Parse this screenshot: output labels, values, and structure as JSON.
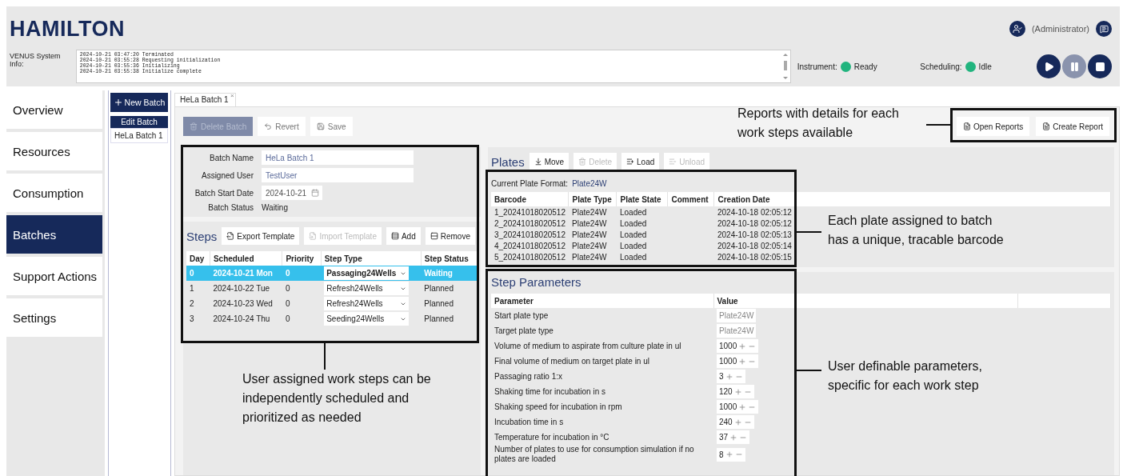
{
  "header": {
    "logo": "HAMILTON",
    "user": "(Administrator)"
  },
  "system_info": {
    "label": "VENUS System Info:",
    "log": [
      "2024-10-21 03:47:20 Terminated",
      "2024-10-21 03:55:28 Requesting initialization",
      "2024-10-21 03:55:36 Initializing",
      "2024-10-21 03:55:38 Initialize complete"
    ]
  },
  "status": [
    {
      "label": "Instrument:",
      "value": "Ready",
      "color": "#21b47e"
    },
    {
      "label": "Scheduling:",
      "value": "Idle",
      "color": "#21b47e"
    }
  ],
  "run_controls": [
    {
      "kind": "play",
      "disabled": false
    },
    {
      "kind": "pause",
      "disabled": true
    },
    {
      "kind": "stop",
      "disabled": false
    }
  ],
  "nav": [
    {
      "label": "Overview",
      "selected": false
    },
    {
      "label": "Resources",
      "selected": false
    },
    {
      "label": "Consumption",
      "selected": false
    },
    {
      "label": "Batches",
      "selected": true
    },
    {
      "label": "Support Actions",
      "selected": false
    },
    {
      "label": "Settings",
      "selected": false
    }
  ],
  "batch_list": {
    "new_button": "New Batch",
    "heading": "Edit Batch",
    "items": [
      "HeLa Batch 1"
    ]
  },
  "tabs": [
    {
      "label": "HeLa Batch 1",
      "selected": true,
      "close": "×"
    }
  ],
  "toolbar": [
    {
      "label": "Delete Batch",
      "kind": "primary",
      "disabled": true
    },
    {
      "label": "Revert",
      "kind": "plain",
      "disabled": false
    },
    {
      "label": "Save",
      "kind": "plain",
      "disabled": false
    }
  ],
  "report_buttons": [
    "Open Reports",
    "Create Report"
  ],
  "batch_form": [
    {
      "label": "Batch Name",
      "value": "HeLa Batch 1",
      "kind": "text"
    },
    {
      "label": "Assigned User",
      "value": "TestUser",
      "kind": "text"
    },
    {
      "label": "Batch Start Date",
      "value": "2024-10-21",
      "kind": "date"
    },
    {
      "label": "Batch Status",
      "value": "Waiting",
      "kind": "static"
    }
  ],
  "steps": {
    "title": "Steps",
    "toolbar": [
      {
        "label": "Export Template",
        "disabled": false
      },
      {
        "label": "Import Template",
        "disabled": true
      },
      {
        "label": "Add",
        "disabled": false
      },
      {
        "label": "Remove",
        "disabled": false
      }
    ],
    "columns": [
      "Day",
      "Scheduled",
      "Priority",
      "Step Type",
      "Step Status"
    ],
    "rows": [
      {
        "day": "0",
        "scheduled": "2024-10-21 Mon",
        "priority": "0",
        "step_type": "Passaging24Wells",
        "status": "Waiting",
        "selected": true
      },
      {
        "day": "1",
        "scheduled": "2024-10-22 Tue",
        "priority": "0",
        "step_type": "Refresh24Wells",
        "status": "Planned",
        "selected": false
      },
      {
        "day": "2",
        "scheduled": "2024-10-23 Wed",
        "priority": "0",
        "step_type": "Refresh24Wells",
        "status": "Planned",
        "selected": false
      },
      {
        "day": "3",
        "scheduled": "2024-10-24 Thu",
        "priority": "0",
        "step_type": "Seeding24Wells",
        "status": "Planned",
        "selected": false
      }
    ]
  },
  "plates": {
    "title": "Plates",
    "toolbar": [
      {
        "label": "Move",
        "disabled": false
      },
      {
        "label": "Delete",
        "disabled": true
      },
      {
        "label": "Load",
        "disabled": false
      },
      {
        "label": "Unload",
        "disabled": true
      }
    ],
    "format_label": "Current Plate Format:",
    "format_value": "Plate24W",
    "columns": [
      "Barcode",
      "Plate Type",
      "Plate State",
      "Comment",
      "Creation Date"
    ],
    "rows": [
      [
        "1_20241018020512",
        "Plate24W",
        "Loaded",
        "",
        "2024-10-18 02:05:12"
      ],
      [
        "2_20241018020512",
        "Plate24W",
        "Loaded",
        "",
        "2024-10-18 02:05:12"
      ],
      [
        "3_20241018020512",
        "Plate24W",
        "Loaded",
        "",
        "2024-10-18 02:05:13"
      ],
      [
        "4_20241018020512",
        "Plate24W",
        "Loaded",
        "",
        "2024-10-18 02:05:14"
      ],
      [
        "5_20241018020512",
        "Plate24W",
        "Loaded",
        "",
        "2024-10-18 02:05:15"
      ]
    ]
  },
  "step_parameters": {
    "title": "Step Parameters",
    "columns": [
      "Parameter",
      "Value"
    ],
    "rows": [
      {
        "label": "Start plate type",
        "value": "Plate24W",
        "kind": "readonly"
      },
      {
        "label": "Target plate type",
        "value": "Plate24W",
        "kind": "readonly"
      },
      {
        "label": "Volume of medium to aspirate from culture plate in ul",
        "value": "1000",
        "kind": "number"
      },
      {
        "label": "Final volume of medium on target plate in ul",
        "value": "1000",
        "kind": "number"
      },
      {
        "label": "Passaging ratio 1:x",
        "value": "3",
        "kind": "number"
      },
      {
        "label": "Shaking time for incubation in s",
        "value": "120",
        "kind": "number"
      },
      {
        "label": "Shaking speed for incubation in rpm",
        "value": "1000",
        "kind": "number"
      },
      {
        "label": "Incubation time in s",
        "value": "240",
        "kind": "number"
      },
      {
        "label": "Temperature for incubation in °C",
        "value": "37",
        "kind": "number"
      },
      {
        "label": "Number of plates to use for consumption simulation if no plates are loaded",
        "value": "8",
        "kind": "number"
      }
    ]
  },
  "annotations": [
    "Reports with details for each work steps available",
    "User assigned work steps can be independently scheduled and prioritized as needed",
    "Each plate assigned to batch has a unique, tracable barcode",
    "User definable parameters, specific for each work step"
  ]
}
